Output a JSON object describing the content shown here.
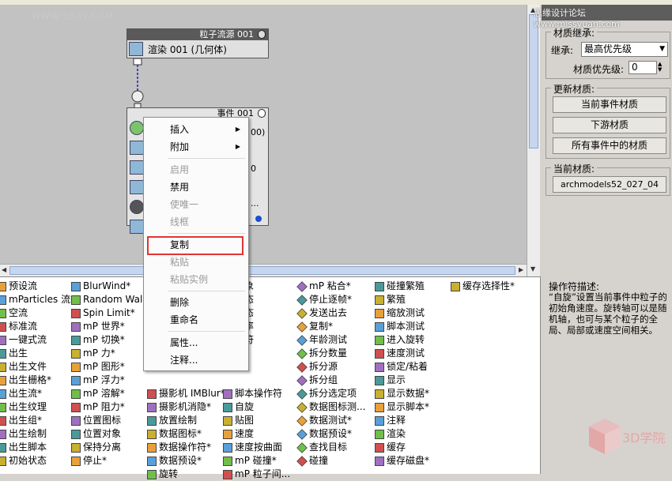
{
  "watermarks": {
    "left": "WWW.3DXY.COM",
    "right": "思缘设计论坛 www.missyuan.com"
  },
  "particle_view": {
    "source_node": {
      "title": "粒子流源 001",
      "row_label": "渲染 001 (几何体)"
    },
    "event_node": {
      "title": "事件 001",
      "partial_rows": [
        "00)",
        "0",
        "..."
      ]
    }
  },
  "context_menu": {
    "items": [
      {
        "label": "插入",
        "disabled": false,
        "submenu": true
      },
      {
        "label": "附加",
        "disabled": false,
        "submenu": true
      },
      {
        "separator": true
      },
      {
        "label": "启用",
        "disabled": true
      },
      {
        "label": "禁用",
        "disabled": false
      },
      {
        "label": "使唯一",
        "disabled": true
      },
      {
        "label": "线框",
        "disabled": true
      },
      {
        "separator": true
      },
      {
        "label": "复制",
        "disabled": false,
        "highlighted": true
      },
      {
        "label": "粘贴",
        "disabled": true
      },
      {
        "label": "粘贴实例",
        "disabled": true
      },
      {
        "separator": true
      },
      {
        "label": "删除",
        "disabled": false
      },
      {
        "label": "重命名",
        "disabled": false
      },
      {
        "separator": true
      },
      {
        "label": "属性...",
        "disabled": false
      },
      {
        "label": "注释...",
        "disabled": false
      }
    ]
  },
  "material_inheritance": {
    "title": "材质继承:",
    "inherit_label": "继承:",
    "inherit_value": "最高优先级",
    "priority_label": "材质优先级:",
    "priority_value": "0"
  },
  "update_material": {
    "title": "更新材质:",
    "buttons": [
      "当前事件材质",
      "下游材质",
      "所有事件中的材质"
    ]
  },
  "current_material": {
    "title": "当前材质:",
    "value": "archmodels52_027_04"
  },
  "operator_description": {
    "title": "操作符描述:",
    "text": "“自旋”设置当前事件中粒子的初始角速度。旋转轴可以是随机轴，也可与某个粒子的全局、局部或速度空间相关。"
  },
  "logo_text": "3D学院",
  "depot": {
    "columns": [
      {
        "items": [
          "预设流",
          "mParticles 流*",
          "空流",
          "标准流",
          "一键式流",
          "出生",
          "出生文件",
          "出生栅格*",
          "出生流*",
          "出生纹理",
          "出生组*",
          "出生绘制",
          "出生脚本",
          "初始状态"
        ]
      },
      {
        "items": [
          "BlurWind*",
          "Random Walk*",
          "Spin Limit*",
          "mP 世界*",
          "mP 切换*",
          "mP 力*",
          "mP 图形*",
          "mP 浮力*",
          "mP 溶解*",
          "mP 阻力*",
          "位置图标",
          "位置对象",
          "保持分离",
          "停止*"
        ]
      },
      {
        "items": [
          "",
          "",
          "",
          "",
          "",
          "",
          "",
          "",
          "摄影机 IMBlur*",
          "摄影机消隐*",
          "放置绘制",
          "数据图标*",
          "数据操作符*",
          "数据预设*",
          "旋转"
        ]
      },
      {
        "items": [
          "对象",
          "动态",
          "静态",
          "频率",
          "作符",
          "择",
          "",
          "",
          "脚本操作符",
          "自旋",
          "贴图",
          "速度",
          "速度按曲面",
          "mP 碰撞*",
          "mP 粒子间..."
        ]
      },
      {
        "items": [
          "mP 粘合*",
          "停止逐帧*",
          "发送出去",
          "复制*",
          "年龄测试",
          "拆分数量",
          "拆分源",
          "拆分组",
          "拆分选定项",
          "数据图标测...",
          "数据测试*",
          "数据预设*",
          "查找目标",
          "碰撞"
        ]
      },
      {
        "items": [
          "碰撞繁殖",
          "繁殖",
          "缩放测试",
          "脚本测试",
          "进入旋转",
          "速度测试",
          "锁定/粘着",
          "显示",
          "显示数据*",
          "显示脚本*",
          "注释",
          "渲染",
          "缓存",
          "缓存磁盘*"
        ]
      },
      {
        "items": [
          "缓存选择性*"
        ]
      }
    ]
  }
}
